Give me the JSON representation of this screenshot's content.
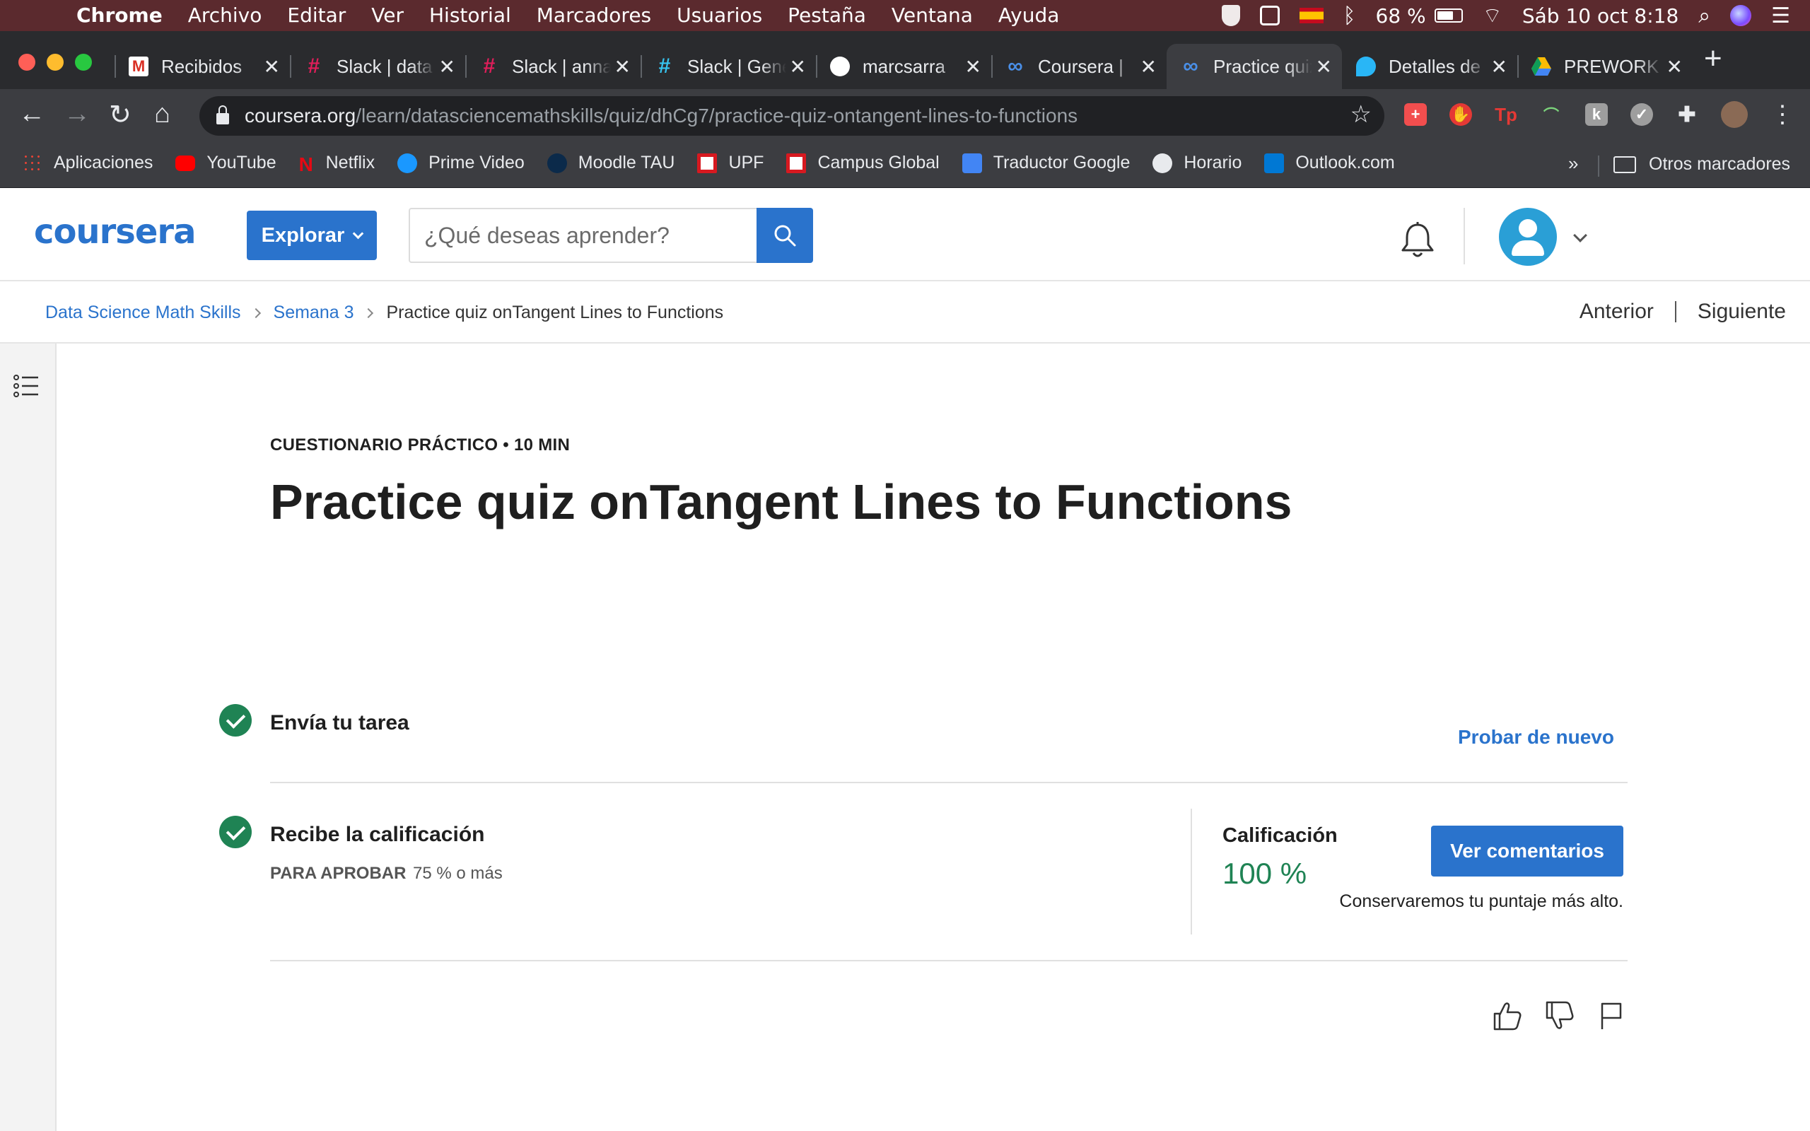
{
  "menubar": {
    "app": "Chrome",
    "menus": [
      "Archivo",
      "Editar",
      "Ver",
      "Historial",
      "Marcadores",
      "Usuarios",
      "Pestaña",
      "Ventana",
      "Ayuda"
    ],
    "battery": "68 %",
    "datetime": "Sáb 10 oct  8:18"
  },
  "tabs": [
    {
      "title": "Recibidos",
      "icon": "gmail-icon",
      "color": "#d93025"
    },
    {
      "title": "Slack | data",
      "icon": "slack-icon",
      "color": "#e01e5a"
    },
    {
      "title": "Slack | anna",
      "icon": "slack-icon",
      "color": "#e01e5a"
    },
    {
      "title": "Slack | General",
      "icon": "slack-icon",
      "color": "#36c5f0"
    },
    {
      "title": "marcsarra",
      "icon": "github-icon",
      "color": "#ffffff"
    },
    {
      "title": "Coursera | ",
      "icon": "coursera-icon",
      "color": "#2a73cc"
    },
    {
      "title": "Practice quiz",
      "icon": "coursera-icon",
      "color": "#4a8fe7",
      "active": true
    },
    {
      "title": "Detalles de",
      "icon": "drop-icon",
      "color": "#29b6f6"
    },
    {
      "title": "PREWORK",
      "icon": "drive-icon",
      "color": "#fbbc04"
    }
  ],
  "address": {
    "domain": "coursera.org",
    "path": "/learn/datasciencemathskills/quiz/dhCg7/practice-quiz-ontangent-lines-to-functions"
  },
  "bookmarks": [
    {
      "label": "Aplicaciones",
      "color": "#ea4335"
    },
    {
      "label": "YouTube",
      "color": "#ff0000"
    },
    {
      "label": "Netflix",
      "color": "#e50914"
    },
    {
      "label": "Prime Video",
      "color": "#1a98ff"
    },
    {
      "label": "Moodle TAU",
      "color": "#0b2a4a"
    },
    {
      "label": "UPF",
      "color": "#d71920"
    },
    {
      "label": "Campus Global",
      "color": "#d71920"
    },
    {
      "label": "Traductor Google",
      "color": "#4285f4"
    },
    {
      "label": "Horario",
      "color": "#e8eaed"
    },
    {
      "label": "Outlook.com",
      "color": "#0078d4"
    }
  ],
  "bookmarks_more": "»",
  "bookmarks_other": "Otros marcadores",
  "header": {
    "logo": "coursera",
    "explore": "Explorar",
    "search_placeholder": "¿Qué deseas aprender?"
  },
  "breadcrumb": {
    "course": "Data Science Math Skills",
    "week": "Semana 3",
    "current": "Practice quiz onTangent Lines to Functions",
    "prev": "Anterior",
    "next": "Siguiente"
  },
  "quiz": {
    "eyebrow": "CUESTIONARIO PRÁCTICO • 10 MIN",
    "title": "Practice quiz onTangent Lines to Functions",
    "step1": "Envía tu tarea",
    "retry": "Probar de nuevo",
    "step2": "Recibe la calificación",
    "pass_label": "PARA APROBAR",
    "pass_value": "75 % o más",
    "grade_label": "Calificación",
    "grade_value": "100 %",
    "feedback_button": "Ver comentarios",
    "keep_note": "Conservaremos tu puntaje más alto."
  },
  "colors": {
    "accent": "#2a73cc",
    "success": "#1f8354"
  }
}
